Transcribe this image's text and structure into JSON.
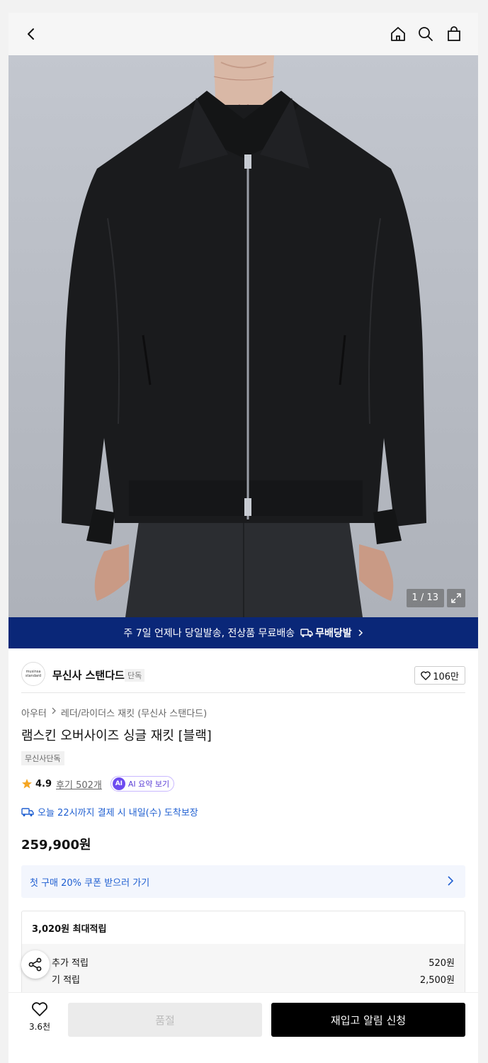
{
  "image_counter": "1 / 13",
  "banner": {
    "text": "주 7일 언제나 당일발송, 전상품 무료배송",
    "brand": "무배당발"
  },
  "store": {
    "logo_text": "musinsa standard",
    "name": "무신사 스탠다드",
    "tag": "단독",
    "likes": "106만"
  },
  "breadcrumb": [
    "아우터",
    "레더/라이더스 재킷 (무신사 스탠다드)"
  ],
  "product": {
    "title": "램스킨 오버사이즈 싱글 재킷 [블랙]",
    "badge": "무신사단독",
    "rating": "4.9",
    "reviews": "후기 502개",
    "ai_badge": "AI",
    "ai_label": "AI 요약 보기",
    "delivery": "오늘 22시까지 결제 시 내일(수) 도착보장",
    "price": "259,900원"
  },
  "coupon": {
    "label": "첫 구매 20% 쿠폰 받으러 가기"
  },
  "points": {
    "header": "3,020원 최대적립",
    "rows": [
      {
        "label": "추가 적립",
        "value": "520원"
      },
      {
        "label": "기 적립",
        "value": "2,500원"
      }
    ]
  },
  "bottom_bar": {
    "likes": "3.6천",
    "soldout_label": "품절",
    "restock_label": "재입고 알림 신청"
  },
  "colors": {
    "banner_bg": "#0a2778",
    "link_blue": "#1f5fd1",
    "accent_purple": "#6d4cf0",
    "star": "#f5a623"
  }
}
